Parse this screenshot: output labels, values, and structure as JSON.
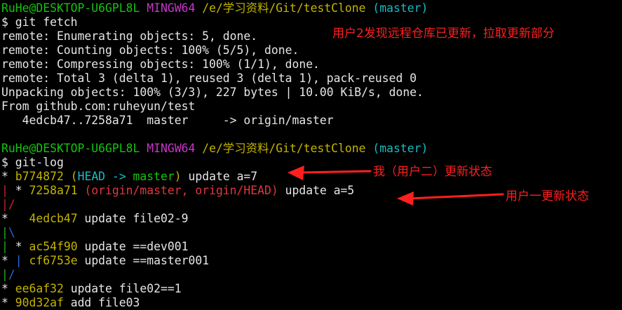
{
  "prompt1": {
    "user_host": "RuHe@DESKTOP-U6GPL8L",
    "shell": "MINGW64",
    "path": "/e/学习资料/Git/testClone",
    "branch": "(master)"
  },
  "cmd1": "$ git fetch",
  "fetch_output": [
    "remote: Enumerating objects: 5, done.",
    "remote: Counting objects: 100% (5/5), done.",
    "remote: Compressing objects: 100% (1/1), done.",
    "remote: Total 3 (delta 1), reused 3 (delta 1), pack-reused 0",
    "Unpacking objects: 100% (3/3), 227 bytes | 10.00 KiB/s, done.",
    "From github.com:ruheyun/test",
    "   4edcb47..7258a71  master     -> origin/master"
  ],
  "prompt2": {
    "user_host": "RuHe@DESKTOP-U6GPL8L",
    "shell": "MINGW64",
    "path": "/e/学习资料/Git/testClone",
    "branch": "(master)"
  },
  "cmd2": "$ git-log",
  "log": {
    "l1": {
      "g": "* ",
      "hash": "b774872",
      "ref_open": " (",
      "head": "HEAD -> ",
      "branch": "master",
      "ref_close": ")",
      "msg": " update a=7"
    },
    "l2": {
      "g1": "| ",
      "g2": "* ",
      "hash": "7258a71",
      "refs": " (origin/master, origin/HEAD)",
      "msg": " update a=5"
    },
    "l3": {
      "g": "|/"
    },
    "l4": {
      "g": "*   ",
      "hash": "4edcb47",
      "msg": " update file02-9"
    },
    "l5": {
      "g1": "|",
      "g2": "\\"
    },
    "l6": {
      "g1": "| ",
      "g2": "* ",
      "hash": "ac54f90",
      "msg": " update ==dev001"
    },
    "l7": {
      "g1": "* ",
      "g2": "| ",
      "hash": "cf6753e",
      "msg": " update ==master001"
    },
    "l8": {
      "g1": "|",
      "g2": "/"
    },
    "l9": {
      "g": "* ",
      "hash": "ee6af32",
      "msg": " update file02==1"
    },
    "l10": {
      "g": "* ",
      "hash": "90d32af",
      "msg": " add file03"
    }
  },
  "annotations": {
    "fetch_note": "用户2发现远程仓库已更新，拉取更新部分",
    "user2_note": "我（用户二）更新状态",
    "user1_note": "用户一更新状态"
  },
  "colors": {
    "annotation": "#ff1f1f",
    "prompt_user": "#13c40e",
    "prompt_shell": "#c835c8",
    "prompt_path": "#c3b400",
    "prompt_branch": "#17bcc5",
    "hash": "#c3b400",
    "head_ref": "#17bcc5",
    "local_branch": "#13c40e",
    "remote_ref": "#e0373e"
  }
}
